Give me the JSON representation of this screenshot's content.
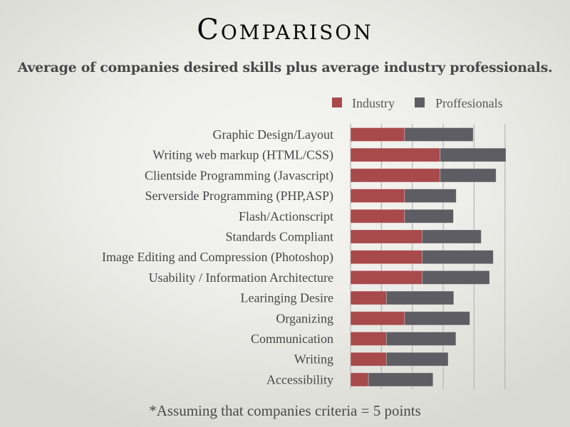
{
  "slide": {
    "title": "Comparison",
    "subtitle": "Average of companies desired skills plus average industry professionals.",
    "footnote": "*Assuming that companies criteria = 5 points"
  },
  "colors": {
    "industry": "#a8494c",
    "professionals": "#5d5d63",
    "gridline": "#b9b9b5"
  },
  "chart_data": {
    "type": "bar",
    "orientation": "horizontal",
    "stacked": true,
    "title": "",
    "xlabel": "",
    "ylabel": "",
    "xlim": [
      0,
      5
    ],
    "grid": true,
    "x_ticks_shown": false,
    "legend": {
      "position": "top-right",
      "entries": [
        "Industry",
        "Proffesionals"
      ]
    },
    "categories": [
      "Graphic Design/Layout",
      "Writing web markup (HTML/CSS)",
      "Clientside Programming (Javascript)",
      "Serverside Programming (PHP,ASP)",
      "Flash/Actionscript",
      "Standards Compliant",
      "Image Editing and Compression (Photoshop)",
      "Usability / Information Architecture",
      "Learinging Desire",
      "Organizing",
      "Communication",
      "Writing",
      "Accessibility"
    ],
    "series": [
      {
        "name": "Industry",
        "values": [
          1.75,
          2.9,
          2.9,
          1.75,
          1.75,
          2.32,
          2.32,
          2.32,
          1.16,
          1.75,
          1.16,
          1.16,
          0.58
        ]
      },
      {
        "name": "Proffesionals",
        "values": [
          2.22,
          2.13,
          1.81,
          1.67,
          1.58,
          1.91,
          2.3,
          2.18,
          2.18,
          2.11,
          2.25,
          2.0,
          2.09
        ]
      }
    ]
  }
}
